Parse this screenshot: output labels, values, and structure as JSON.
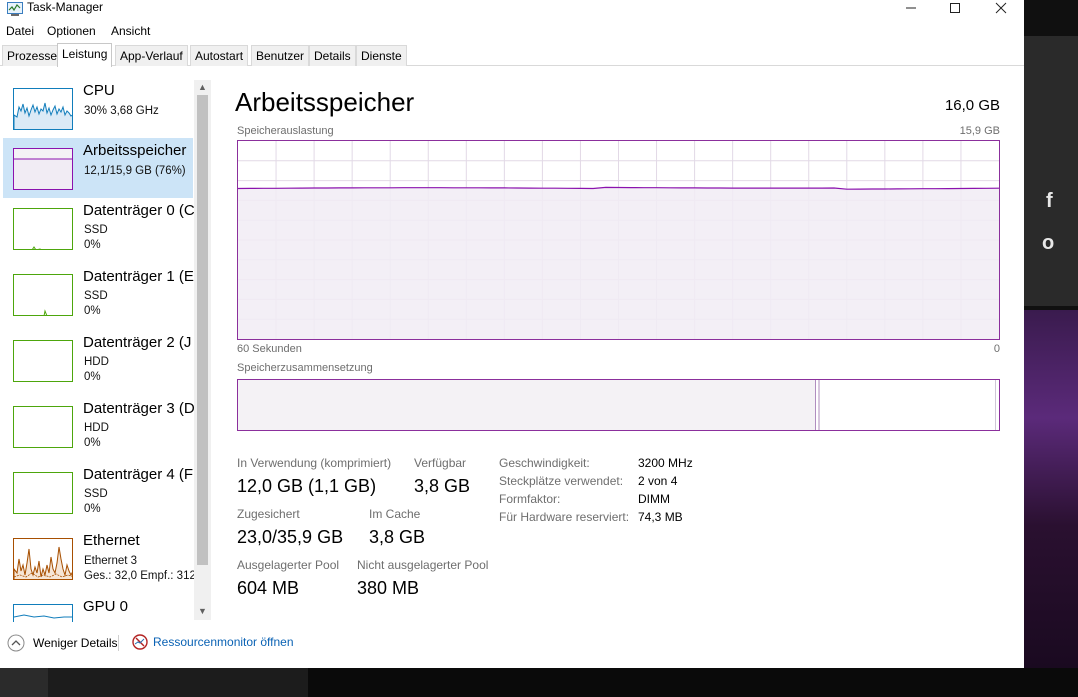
{
  "window": {
    "title": "Task-Manager",
    "minimize_icon": "minimize-icon",
    "maximize_icon": "maximize-icon",
    "close_icon": "close-icon"
  },
  "menu": {
    "items": [
      "Datei",
      "Optionen",
      "Ansicht"
    ]
  },
  "tabs": [
    "Prozesse",
    "Leistung",
    "App-Verlauf",
    "Autostart",
    "Benutzer",
    "Details",
    "Dienste"
  ],
  "active_tab": "Leistung",
  "sidebar": {
    "items": [
      {
        "title": "CPU",
        "line1": "30%  3,68 GHz",
        "line2": "",
        "color": "#117dbb",
        "percent": 30
      },
      {
        "title": "Arbeitsspeicher",
        "line1": "12,1/15,9 GB (76%)",
        "line2": "",
        "color": "#8b12ae",
        "percent": 76
      },
      {
        "title": "Datenträger 0 (C",
        "line1": "SSD",
        "line2": "0%",
        "color": "#4da60c",
        "percent": 0
      },
      {
        "title": "Datenträger 1 (E",
        "line1": "SSD",
        "line2": "0%",
        "color": "#4da60c",
        "percent": 0
      },
      {
        "title": "Datenträger 2 (J",
        "line1": "HDD",
        "line2": "0%",
        "color": "#4da60c",
        "percent": 0
      },
      {
        "title": "Datenträger 3 (D",
        "line1": "HDD",
        "line2": "0%",
        "color": "#4da60c",
        "percent": 0
      },
      {
        "title": "Datenträger 4 (F",
        "line1": "SSD",
        "line2": "0%",
        "color": "#4da60c",
        "percent": 0
      },
      {
        "title": "Ethernet",
        "line1": "Ethernet 3",
        "line2": "Ges.: 32,0  Empf.: 312",
        "color": "#a74f01",
        "percent": 0
      },
      {
        "title": "GPU 0",
        "line1": "",
        "line2": "",
        "color": "#117dbb",
        "percent": 0
      }
    ]
  },
  "main": {
    "title": "Arbeitsspeicher",
    "total": "16,0 GB",
    "graph_label": "Speicherauslastung",
    "graph_max": "15,9 GB",
    "time_label": "60 Sekunden",
    "time_end": "0",
    "composition_label": "Speicherzusammensetzung",
    "usage_percent": 76,
    "accent_color": "#8b12ae"
  },
  "stats": {
    "in_use_label": "In Verwendung (komprimiert)",
    "in_use_value": "12,0 GB (1,1 GB)",
    "available_label": "Verfügbar",
    "available_value": "3,8 GB",
    "committed_label": "Zugesichert",
    "committed_value": "23,0/35,9 GB",
    "cached_label": "Im Cache",
    "cached_value": "3,8 GB",
    "paged_label": "Ausgelagerter Pool",
    "paged_value": "604 MB",
    "nonpaged_label": "Nicht ausgelagerter Pool",
    "nonpaged_value": "380 MB"
  },
  "details": [
    {
      "key": "Geschwindigkeit:",
      "value": "3200 MHz"
    },
    {
      "key": "Steckplätze verwendet:",
      "value": "2 von 4"
    },
    {
      "key": "Formfaktor:",
      "value": "DIMM"
    },
    {
      "key": "Für Hardware reserviert:",
      "value": "74,3 MB"
    }
  ],
  "footer": {
    "fewer_details": "Weniger Details",
    "resource_monitor": "Ressourcenmonitor öffnen",
    "fewer_details_icon": "chevron-up-circle-icon",
    "resource_monitor_icon": "resource-monitor-icon"
  }
}
